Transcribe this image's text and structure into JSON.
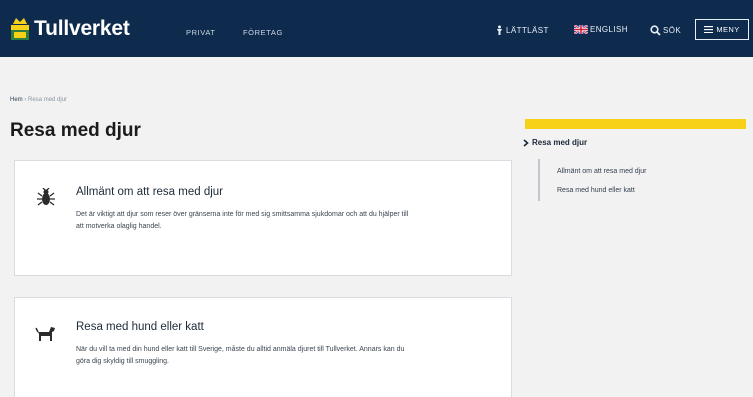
{
  "header": {
    "logo_text": "Tullverket",
    "nav": [
      "PRIVAT",
      "FÖRETAG"
    ],
    "util": {
      "lattlast": "LÄTTLÄST",
      "english": "ENGLISH",
      "sok": "SÖK",
      "menu": "MENY"
    }
  },
  "breadcrumb": {
    "home": "Hem",
    "separator": "›",
    "current": "Resa med djur"
  },
  "page_title": "Resa med djur",
  "cards": [
    {
      "title": "Allmänt om att resa med djur",
      "description": "Det är viktigt att djur som reser över gränserna inte för med sig smittsamma sjukdomar och att du hjälper till att motverka olaglig handel.",
      "icon": "bug-icon"
    },
    {
      "title": "Resa med hund eller katt",
      "description": "När du vill ta med din hund eller katt till Sverige, måste du alltid anmäla djuret till Tullverket. Annars kan du göra dig skyldig till smuggling.",
      "icon": "dog-icon"
    }
  ],
  "sidebar": {
    "heading": "Resa med djur",
    "links": [
      "Allmänt om att resa med djur",
      "Resa med hund eller katt"
    ]
  },
  "colors": {
    "header_bg": "#0e2a4d",
    "accent_yellow": "#f6d118",
    "page_bg": "#f2f2f2"
  }
}
